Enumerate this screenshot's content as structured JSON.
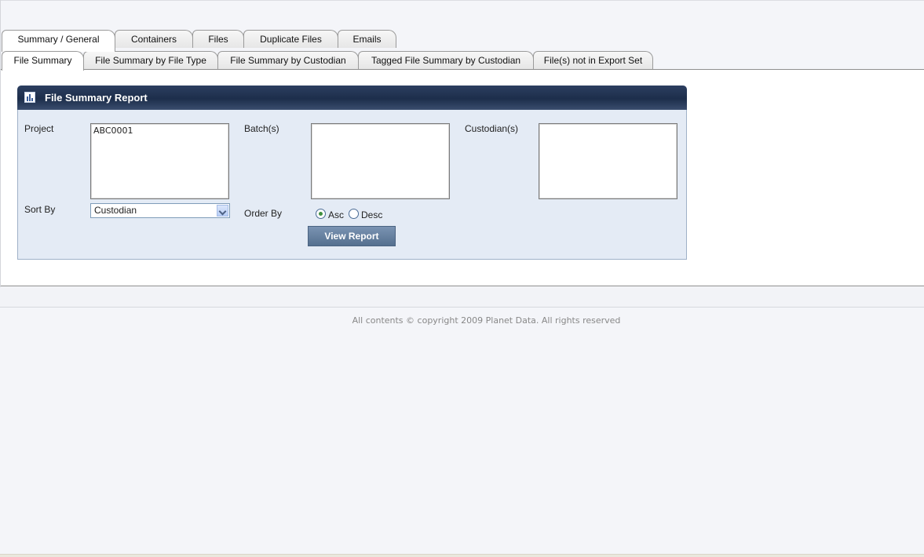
{
  "tabs_row1": [
    {
      "label": "Summary / General",
      "active": true
    },
    {
      "label": "Containers",
      "active": false
    },
    {
      "label": "Files",
      "active": false
    },
    {
      "label": "Duplicate Files",
      "active": false
    },
    {
      "label": "Emails",
      "active": false
    }
  ],
  "tabs_row2": [
    {
      "label": "File Summary",
      "active": true
    },
    {
      "label": "File Summary by File Type",
      "active": false
    },
    {
      "label": "File Summary by Custodian",
      "active": false
    },
    {
      "label": "Tagged File Summary by Custodian",
      "active": false
    },
    {
      "label": "File(s) not in Export Set",
      "active": false
    }
  ],
  "report": {
    "title": "File Summary Report",
    "icon": "report-chart-icon",
    "project_label": "Project",
    "project_items": [
      "ABC0001"
    ],
    "batches_label": "Batch(s)",
    "batch_items": [],
    "custodians_label": "Custodian(s)",
    "custodian_items": [],
    "sort_by_label": "Sort By",
    "sort_by_value": "Custodian",
    "order_by_label": "Order By",
    "order_asc_label": "Asc",
    "order_desc_label": "Desc",
    "order_selected": "Asc",
    "view_button": "View Report"
  },
  "footer": "All contents © copyright 2009 Planet Data. All rights reserved",
  "colors": {
    "header_dark": "#1d2e4b",
    "panel_bg": "#e4ebf5",
    "button": "#5f7a9a"
  }
}
